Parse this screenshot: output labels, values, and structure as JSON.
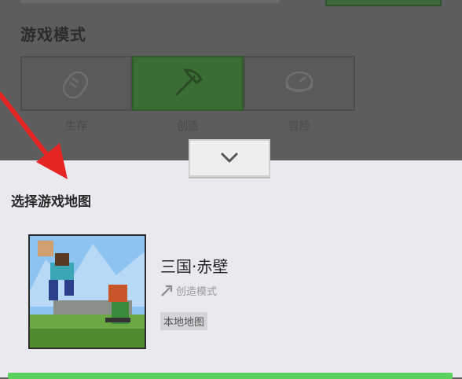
{
  "top": {
    "section_title": "游戏模式",
    "modes": [
      {
        "label": "生存",
        "icon": "bread-icon",
        "active": false
      },
      {
        "label": "创造",
        "icon": "pickaxe-icon",
        "active": true
      },
      {
        "label": "冒险",
        "icon": "compass-icon",
        "active": false
      }
    ]
  },
  "sheet": {
    "collapse_icon": "chevron-down-icon",
    "title": "选择游戏地图",
    "map": {
      "name": "三国·赤壁",
      "mode_label": "创造模式",
      "tag": "本地地图"
    }
  },
  "colors": {
    "active_mode": "#3a6d33",
    "arrow": "#e52424",
    "bottom_button": "#5ad15a"
  }
}
